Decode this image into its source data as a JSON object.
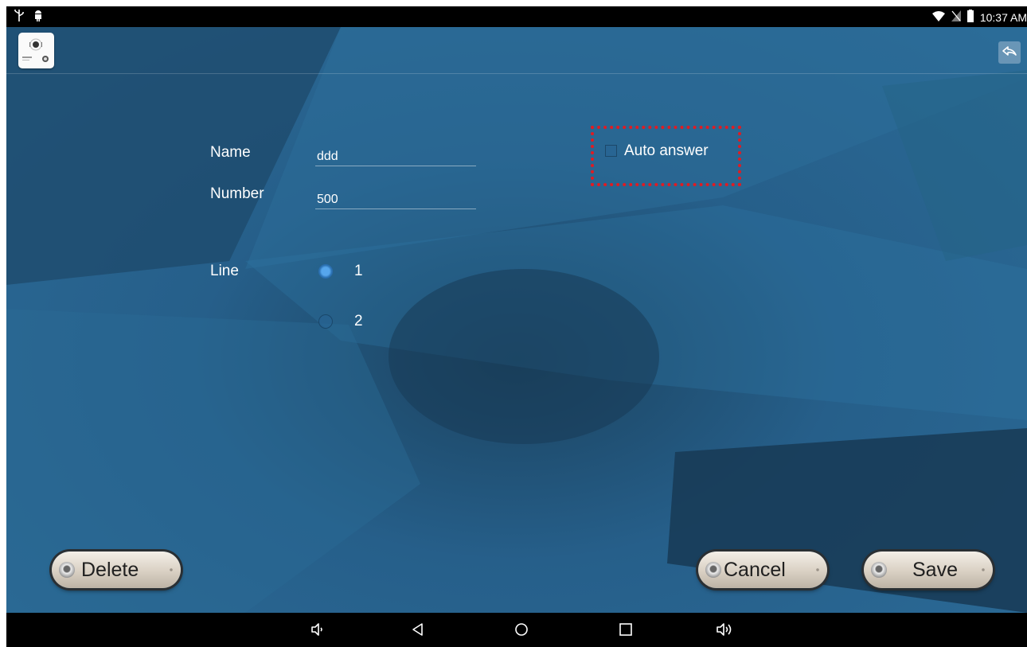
{
  "status_bar": {
    "time": "10:37 AM",
    "left_icons": [
      "usb-icon",
      "android-debug-icon"
    ],
    "right_icons": [
      "wifi-icon",
      "no-sim-icon",
      "battery-icon"
    ]
  },
  "app_bar": {
    "app_icon": "app-logo-icon",
    "back_icon": "back-arrow-icon"
  },
  "form": {
    "name_label": "Name",
    "name_value": "ddd",
    "number_label": "Number",
    "number_value": "500",
    "line_label": "Line",
    "line_options": [
      {
        "label": "1",
        "checked": true
      },
      {
        "label": "2",
        "checked": false
      }
    ],
    "auto_answer_label": "Auto answer",
    "auto_answer_checked": false,
    "highlight_color": "#e11b22"
  },
  "buttons": {
    "delete": "Delete",
    "cancel": "Cancel",
    "save": "Save"
  },
  "nav_bar": {
    "icons": [
      "volume-down-icon",
      "back-icon",
      "home-icon",
      "recents-icon",
      "volume-up-icon"
    ]
  }
}
